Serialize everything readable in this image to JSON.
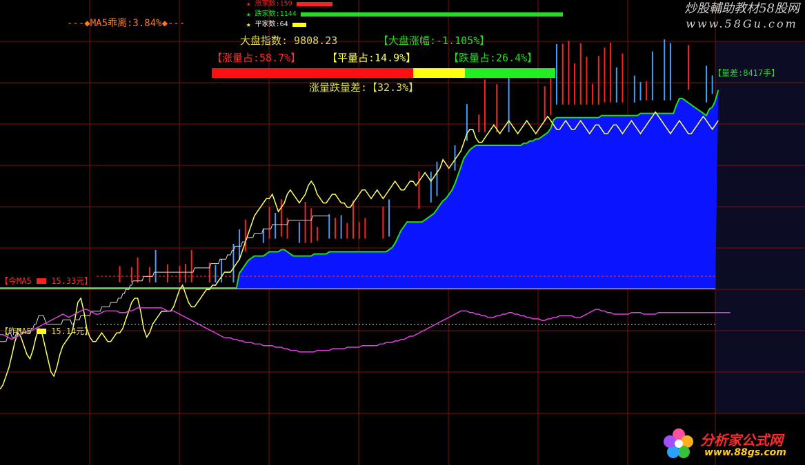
{
  "colors": {
    "up": "#ff2020",
    "down": "#22dd22",
    "flat": "#ffff22",
    "area": "#0a14ff",
    "index_line": "#ffff66",
    "ma_line": "#e040e0",
    "grid": "#7a1010",
    "label": "#dddd55",
    "green_text": "#22dd22",
    "red_text": "#ff3030",
    "orange_text": "#ff7a22",
    "white_line": "#cccccc"
  },
  "header": {
    "ma5_deviation": "---◆MA5乖离:3.84%◆---",
    "legend": [
      {
        "icon": "star-icon",
        "label": "涨家数:159",
        "value": 159,
        "color": "#ff2020"
      },
      {
        "icon": "star-icon",
        "label": "跌家数:1144",
        "value": 1144,
        "color": "#22dd22"
      },
      {
        "icon": "star-icon",
        "label": "平家数:64",
        "value": 64,
        "color": "#ffff22"
      }
    ],
    "index_label": "大盘指数: 9808.23",
    "index_change": "【大盘涨幅:-1.105%】",
    "up_volume_share": "【涨量占:58.7%】",
    "flat_volume_share": "【平量占:14.9%】",
    "down_volume_share": "【跌量占:26.4%】",
    "volume_shares": {
      "up": 58.7,
      "flat": 14.9,
      "down": 26.4
    },
    "volume_diff": "涨量跌量差:【32.3%】",
    "volume_gap": "【量差:8417手】",
    "today_ma5": "【今MA5",
    "today_ma5_value": "15.33元】",
    "prev_ma5": "【昨MA5",
    "prev_ma5_value": "15.14元】"
  },
  "watermarks": {
    "top_title": "炒股輔助教材58股网",
    "top_url": "www.58Gu.com",
    "bottom_title": "分析家公式网",
    "bottom_url": "www.88gs.com"
  },
  "chart_data": {
    "type": "line",
    "title": "",
    "x_count": 240,
    "series": [
      {
        "name": "",
        "style": "filled-area",
        "values_desc": "Blue volume area (relative level)",
        "values": [
          0.0,
          0.0,
          0.0,
          0.0,
          0.0,
          0.0,
          0.0,
          0.0,
          0.0,
          0.0,
          0.0,
          0.0,
          0.0,
          0.0,
          0.0,
          0.0,
          0.0,
          0.0,
          0.0,
          0.0,
          0.0,
          0.0,
          0.0,
          0.0,
          0.0,
          0.0,
          0.0,
          0.0,
          0.0,
          0.0,
          0.0,
          0.0,
          0.0,
          0.0,
          0.0,
          0.0,
          0.0,
          0.0,
          0.0,
          0.0,
          0.0,
          0.0,
          0.0,
          0.0,
          0.0,
          0.0,
          0.0,
          0.0,
          0.0,
          0.0,
          0.0,
          0.0,
          0.0,
          0.0,
          0.0,
          0.0,
          0.0,
          0.0,
          0.0,
          0.0,
          0.0,
          0.0,
          0.0,
          0.0,
          0.0,
          0.0,
          0.0,
          0.0,
          0.0,
          0.0,
          0.0,
          0.0,
          0.0,
          0.0,
          0.0,
          0.0,
          0.0,
          0.0,
          0.0,
          0.0,
          0.07,
          0.09,
          0.11,
          0.13,
          0.14,
          0.15,
          0.15,
          0.15,
          0.15,
          0.16,
          0.17,
          0.17,
          0.17,
          0.17,
          0.18,
          0.18,
          0.17,
          0.16,
          0.15,
          0.15,
          0.15,
          0.15,
          0.15,
          0.15,
          0.15,
          0.16,
          0.16,
          0.16,
          0.16,
          0.16,
          0.17,
          0.17,
          0.17,
          0.17,
          0.17,
          0.17,
          0.17,
          0.17,
          0.17,
          0.17,
          0.17,
          0.17,
          0.17,
          0.17,
          0.17,
          0.17,
          0.17,
          0.17,
          0.17,
          0.17,
          0.18,
          0.19,
          0.21,
          0.24,
          0.27,
          0.29,
          0.31,
          0.31,
          0.31,
          0.31,
          0.31,
          0.31,
          0.32,
          0.33,
          0.34,
          0.35,
          0.37,
          0.39,
          0.41,
          0.42,
          0.44,
          0.46,
          0.49,
          0.53,
          0.57,
          0.61,
          0.63,
          0.65,
          0.66,
          0.67,
          0.67,
          0.67,
          0.67,
          0.67,
          0.67,
          0.67,
          0.67,
          0.67,
          0.67,
          0.67,
          0.67,
          0.67,
          0.67,
          0.67,
          0.67,
          0.68,
          0.68,
          0.69,
          0.69,
          0.7,
          0.7,
          0.71,
          0.72,
          0.73,
          0.75,
          0.79,
          0.8,
          0.8,
          0.8,
          0.8,
          0.8,
          0.8,
          0.8,
          0.8,
          0.8,
          0.8,
          0.8,
          0.8,
          0.8,
          0.8,
          0.8,
          0.81,
          0.81,
          0.81,
          0.81,
          0.81,
          0.81,
          0.81,
          0.81,
          0.81,
          0.81,
          0.81,
          0.81,
          0.81,
          0.82,
          0.82,
          0.82,
          0.82,
          0.82,
          0.82,
          0.82,
          0.82,
          0.82,
          0.82,
          0.82,
          0.82,
          0.86,
          0.89,
          0.89,
          0.88,
          0.87,
          0.86,
          0.85,
          0.84,
          0.83,
          0.82,
          0.81,
          0.84,
          0.85,
          0.88,
          0.93
        ]
      },
      {
        "name": "",
        "style": "line",
        "values": [
          0.39,
          0.4,
          0.42,
          0.44,
          0.47,
          0.5,
          0.52,
          0.51,
          0.49,
          0.47,
          0.46,
          0.48,
          0.51,
          0.53,
          0.52,
          0.49,
          0.46,
          0.43,
          0.42,
          0.44,
          0.47,
          0.49,
          0.5,
          0.51,
          0.52,
          0.55,
          0.59,
          0.6,
          0.57,
          0.53,
          0.51,
          0.5,
          0.5,
          0.51,
          0.52,
          0.51,
          0.5,
          0.5,
          0.51,
          0.52,
          0.52,
          0.53,
          0.55,
          0.57,
          0.59,
          0.6,
          0.6,
          0.57,
          0.53,
          0.51,
          0.52,
          0.54,
          0.55,
          0.56,
          0.57,
          0.57,
          0.57,
          0.57,
          0.58,
          0.6,
          0.62,
          0.63,
          0.61,
          0.59,
          0.58,
          0.58,
          0.59,
          0.6,
          0.61,
          0.62,
          0.62,
          0.63,
          0.63,
          0.64,
          0.65,
          0.66,
          0.66,
          0.66,
          0.67,
          0.68,
          0.69,
          0.71,
          0.73,
          0.75,
          0.77,
          0.79,
          0.8,
          0.81,
          0.82,
          0.83,
          0.83,
          0.84,
          0.82,
          0.8,
          0.81,
          0.82,
          0.84,
          0.85,
          0.84,
          0.83,
          0.82,
          0.83,
          0.84,
          0.86,
          0.87,
          0.86,
          0.84,
          0.83,
          0.82,
          0.82,
          0.83,
          0.84,
          0.84,
          0.83,
          0.82,
          0.82,
          0.81,
          0.81,
          0.82,
          0.83,
          0.84,
          0.85,
          0.85,
          0.84,
          0.83,
          0.84,
          0.85,
          0.84,
          0.83,
          0.84,
          0.85,
          0.86,
          0.87,
          0.86,
          0.85,
          0.85,
          0.86,
          0.87,
          0.87,
          0.86,
          0.87,
          0.88,
          0.89,
          0.88,
          0.87,
          0.88,
          0.89,
          0.9,
          0.92,
          0.91,
          0.9,
          0.91,
          0.92,
          0.93,
          0.94,
          0.96,
          0.98,
          0.99,
          0.99,
          0.97,
          0.96,
          0.96,
          0.97,
          0.98,
          0.99,
          1.0,
          0.99,
          0.98,
          0.99,
          1.0,
          1.01,
          1.0,
          0.99,
          0.98,
          0.99,
          1.0,
          1.01,
          1.0,
          0.99,
          0.98,
          0.99,
          1.0,
          1.01,
          1.02,
          1.01,
          1.0,
          0.99,
          0.99,
          1.0,
          1.01,
          1.0,
          0.99,
          0.99,
          1.0,
          1.01,
          1.0,
          0.99,
          0.98,
          0.99,
          1.0,
          1.0,
          0.99,
          0.98,
          0.98,
          0.99,
          1.0,
          1.0,
          0.99,
          0.98,
          0.99,
          1.0,
          1.01,
          1.0,
          0.99,
          0.98,
          0.99,
          1.0,
          1.01,
          1.02,
          1.03,
          1.02,
          1.01,
          1.0,
          0.99,
          0.98,
          0.99,
          1.0,
          1.01,
          1.0,
          0.99,
          0.98,
          0.98,
          0.99,
          1.0,
          1.01,
          1.02,
          1.01,
          1.0,
          0.99,
          1.0,
          1.01
        ]
      },
      {
        "name": "",
        "style": "line",
        "values": [
          0.5,
          0.5,
          0.5,
          0.5,
          0.5,
          0.51,
          0.52,
          0.52,
          0.51,
          0.51,
          0.51,
          0.52,
          0.53,
          0.53,
          0.52,
          0.52,
          0.52,
          0.52,
          0.52,
          0.52,
          0.52,
          0.53,
          0.53,
          0.54,
          0.54,
          0.55,
          0.56,
          0.56,
          0.56,
          0.56,
          0.55,
          0.54,
          0.54,
          0.54,
          0.54,
          0.54,
          0.54,
          0.54,
          0.54,
          0.54,
          0.54,
          0.54,
          0.55,
          0.55,
          0.55,
          0.55,
          0.55,
          0.55,
          0.54,
          0.54,
          0.55,
          0.55,
          0.55,
          0.55,
          0.56,
          0.56,
          0.56,
          0.56,
          0.56,
          0.56,
          0.56,
          0.57,
          0.57,
          0.57,
          0.57,
          0.57,
          0.57,
          0.57,
          0.58,
          0.58,
          0.58,
          0.58,
          0.58,
          0.58,
          0.59,
          0.59,
          0.59,
          0.59,
          0.59,
          0.6,
          0.6,
          0.6,
          0.61,
          0.61,
          0.62,
          0.62,
          0.62,
          0.63,
          0.63,
          0.64,
          0.64,
          0.64,
          0.64,
          0.64,
          0.64,
          0.64,
          0.65,
          0.65,
          0.65,
          0.65,
          0.65,
          0.65,
          0.65,
          0.66,
          0.66,
          0.66,
          0.66,
          0.66,
          0.66,
          0.66,
          0.66,
          0.66,
          0.66,
          0.66,
          0.66,
          0.66,
          0.66,
          0.66,
          0.66,
          0.66,
          0.66,
          0.66,
          0.66,
          0.66,
          0.66,
          0.66,
          0.66,
          0.66,
          0.66,
          0.66,
          0.67,
          0.67,
          0.67,
          0.67,
          0.67,
          0.67,
          0.67,
          0.67,
          0.67,
          0.67,
          0.67,
          0.68,
          0.68,
          0.68,
          0.68,
          0.68,
          0.68,
          0.69,
          0.69,
          0.69,
          0.69,
          0.69,
          0.7,
          0.7,
          0.7,
          0.71,
          0.71,
          0.72,
          0.72,
          0.72,
          0.72,
          0.72,
          0.73,
          0.73,
          0.73,
          0.74,
          0.74,
          0.74,
          0.74,
          0.74,
          0.75,
          0.75,
          0.75,
          0.75,
          0.75,
          0.75,
          0.76,
          0.76,
          0.76,
          0.76,
          0.76,
          0.76,
          0.77,
          0.77,
          0.77,
          0.77,
          0.77,
          0.77,
          0.77,
          0.77,
          0.77,
          0.77,
          0.77,
          0.78,
          0.78,
          0.78,
          0.78,
          0.78,
          0.78,
          0.78,
          0.78,
          0.78,
          0.78,
          0.78,
          0.78,
          0.78,
          0.78,
          0.78,
          0.78,
          0.79,
          0.79,
          0.79,
          0.79,
          0.79,
          0.79,
          0.79,
          0.79,
          0.79,
          0.79,
          0.79,
          0.79,
          0.79,
          0.79,
          0.79,
          0.79,
          0.79,
          0.8,
          0.8,
          0.8,
          0.8,
          0.8,
          0.8,
          0.8,
          0.8,
          0.8,
          0.8,
          0.8,
          0.8,
          0.8,
          0.8,
          0.8,
          0.8,
          0.8,
          0.8,
          0.8
        ]
      },
      {
        "name": "",
        "style": "line",
        "values": [
          0.45,
          0.45,
          0.44,
          0.43,
          0.42,
          0.43,
          0.44,
          0.45,
          0.46,
          0.47,
          0.47,
          0.48,
          0.49,
          0.5,
          0.51,
          0.52,
          0.53,
          0.54,
          0.55,
          0.56,
          0.57,
          0.58,
          0.57,
          0.56,
          0.57,
          0.58,
          0.59,
          0.6,
          0.61,
          0.61,
          0.6,
          0.59,
          0.58,
          0.58,
          0.59,
          0.6,
          0.6,
          0.6,
          0.6,
          0.6,
          0.59,
          0.59,
          0.59,
          0.6,
          0.6,
          0.61,
          0.62,
          0.62,
          0.62,
          0.62,
          0.62,
          0.62,
          0.62,
          0.62,
          0.62,
          0.61,
          0.6,
          0.6,
          0.6,
          0.59,
          0.58,
          0.57,
          0.56,
          0.55,
          0.54,
          0.53,
          0.52,
          0.51,
          0.5,
          0.49,
          0.48,
          0.47,
          0.46,
          0.45,
          0.44,
          0.43,
          0.43,
          0.43,
          0.42,
          0.42,
          0.41,
          0.41,
          0.4,
          0.4,
          0.4,
          0.39,
          0.39,
          0.39,
          0.38,
          0.38,
          0.38,
          0.38,
          0.37,
          0.37,
          0.37,
          0.36,
          0.36,
          0.35,
          0.35,
          0.35,
          0.34,
          0.34,
          0.34,
          0.34,
          0.34,
          0.34,
          0.35,
          0.35,
          0.35,
          0.35,
          0.35,
          0.36,
          0.36,
          0.36,
          0.36,
          0.36,
          0.37,
          0.37,
          0.37,
          0.37,
          0.37,
          0.38,
          0.38,
          0.38,
          0.38,
          0.38,
          0.38,
          0.39,
          0.39,
          0.4,
          0.4,
          0.4,
          0.41,
          0.41,
          0.42,
          0.42,
          0.43,
          0.44,
          0.44,
          0.45,
          0.46,
          0.47,
          0.48,
          0.49,
          0.5,
          0.51,
          0.52,
          0.53,
          0.54,
          0.55,
          0.56,
          0.57,
          0.58,
          0.59,
          0.6,
          0.6,
          0.6,
          0.59,
          0.59,
          0.58,
          0.58,
          0.57,
          0.57,
          0.56,
          0.56,
          0.56,
          0.57,
          0.57,
          0.58,
          0.58,
          0.59,
          0.59,
          0.58,
          0.58,
          0.57,
          0.57,
          0.56,
          0.56,
          0.55,
          0.55,
          0.55,
          0.54,
          0.54,
          0.55,
          0.55,
          0.56,
          0.56,
          0.57,
          0.57,
          0.57,
          0.57,
          0.57,
          0.56,
          0.56,
          0.56,
          0.57,
          0.58,
          0.59,
          0.6,
          0.61,
          0.61,
          0.6,
          0.6,
          0.59,
          0.59,
          0.58,
          0.58,
          0.58,
          0.58,
          0.58,
          0.58,
          0.59,
          0.59,
          0.59,
          0.59,
          0.58,
          0.58,
          0.58,
          0.58,
          0.58,
          0.59,
          0.59,
          0.59,
          0.59,
          0.59,
          0.59,
          0.59,
          0.59,
          0.59,
          0.59,
          0.59,
          0.59,
          0.59,
          0.59,
          0.59,
          0.59,
          0.59,
          0.59,
          0.59,
          0.59,
          0.59,
          0.59,
          0.59,
          0.59,
          0.59
        ]
      }
    ]
  }
}
